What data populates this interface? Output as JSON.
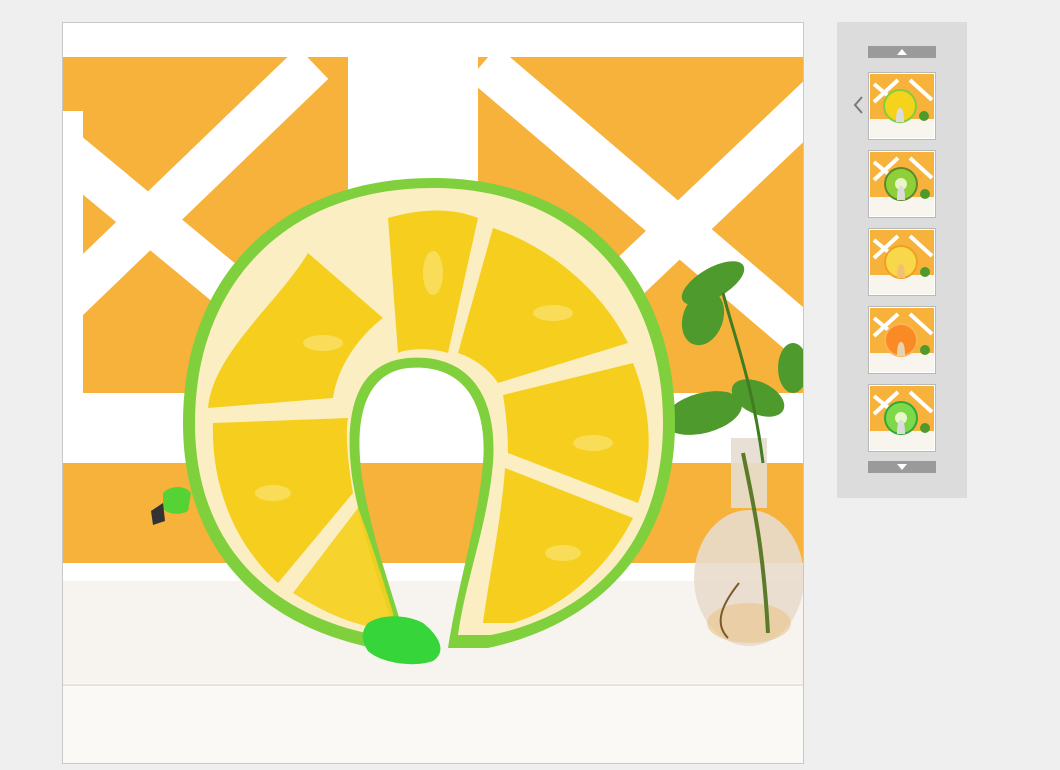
{
  "gallery": {
    "main_image_icon": "lemon-neck-pillow-photo",
    "scroll_up_icon": "chevron-up-icon",
    "scroll_down_icon": "chevron-down-icon",
    "prev_icon": "chevron-left-icon",
    "thumbnails": [
      {
        "icon": "lemon-pillow-thumbnail",
        "color": "#f5d31a",
        "accent": "#7bd13b"
      },
      {
        "icon": "kiwi-pillow-thumbnail",
        "color": "#8fd039",
        "accent": "#4a7a1c"
      },
      {
        "icon": "pineapple-pillow-thumbnail",
        "color": "#f8d84a",
        "accent": "#f0a020"
      },
      {
        "icon": "orange-pillow-thumbnail",
        "color": "#f98a24",
        "accent": "#ffb254"
      },
      {
        "icon": "watermelon-pillow-thumbnail",
        "color": "#7ed84a",
        "accent": "#e7f7c8"
      }
    ],
    "colors": {
      "background": "#efefef",
      "panel": "#dcdcdc",
      "scroll_button": "#9a9a9a",
      "wall": "#f7b338",
      "lattice": "#ffffff",
      "lemon_flesh": "#f6cf1e",
      "lemon_pith": "#fbeec0",
      "lemon_rind": "#7fd03c"
    }
  }
}
